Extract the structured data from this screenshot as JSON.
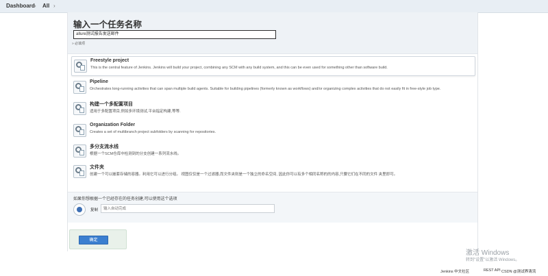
{
  "breadcrumb": {
    "items": [
      "Dashboard",
      "All"
    ],
    "separator": "›"
  },
  "form": {
    "title": "输入一个任务名称",
    "name_value": "allure测试报告发送邮件",
    "required_hint": "» 必填项"
  },
  "job_types": [
    {
      "name": "Freestyle project",
      "description": "This is the central feature of Jenkins. Jenkins will build your project, combining any SCM with any build system, and this can be even used for something other than software build.",
      "selected": true
    },
    {
      "name": "Pipeline",
      "description": "Orchestrates long-running activities that can span multiple build agents. Suitable for building pipelines (formerly known as workflows) and/or organizing complex activities that do not easily fit in free-style job type.",
      "selected": false
    },
    {
      "name": "构建一个多配置项目",
      "description": "适用于多配置项目,例如多环境测试,平台指定构建,等等.",
      "selected": false
    },
    {
      "name": "Organization Folder",
      "description": "Creates a set of multibranch project subfolders by scanning for repositories.",
      "selected": false
    },
    {
      "name": "多分支流水线",
      "description": "根据一个SCM仓库中检测到的分支创建一系列流水线。",
      "selected": false
    },
    {
      "name": "文件夹",
      "description": "创建一个可以嵌套存储的容器。利用它可以进行分组。 视图仅仅是一个过滤器,而文件夹则是一个独立的命名空间, 因此你可以有多个相同名称的的内容,只要它们在不同的文件 夹里即可。",
      "selected": false
    }
  ],
  "copy": {
    "heading": "如果你想根据一个已经存在的任务创建,可以使用这个选项",
    "label": "复制",
    "placeholder": "输入自动完成"
  },
  "ok_label": "确定",
  "footer": {
    "community": "Jenkins 中文社区",
    "rest_api": "REST API",
    "csdn": "CSDN @测试界清流"
  },
  "watermark": {
    "line1": "激活 Windows",
    "line2": "转到\"设置\"以激活 Windows。"
  },
  "colors": {
    "primary_button": "#3b7fd0",
    "header_band": "#eef2f6",
    "top_bar": "#e8eef4"
  }
}
